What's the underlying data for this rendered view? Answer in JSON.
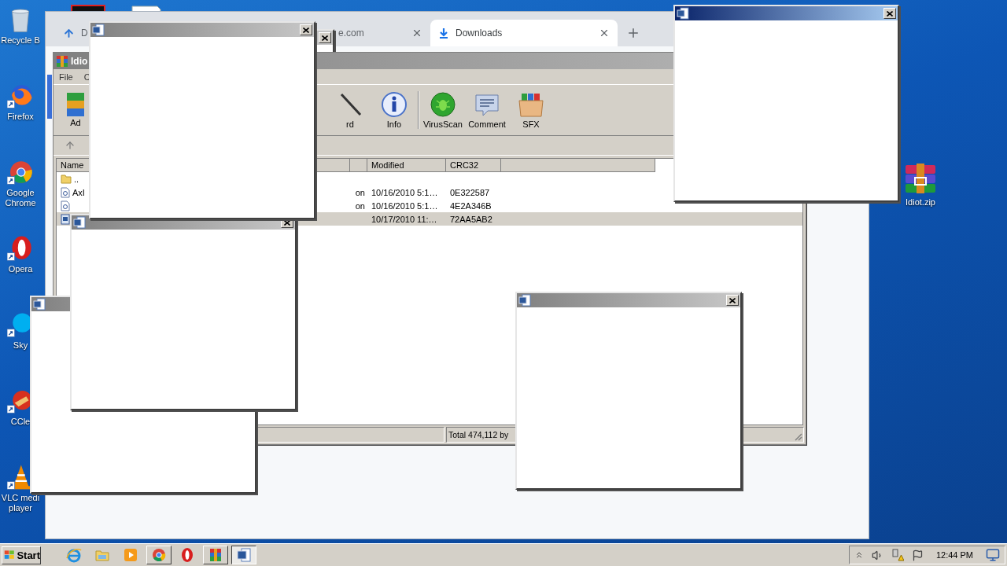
{
  "desktop_icons": [
    {
      "label": "Recycle B",
      "kind": "recycle"
    },
    {
      "label": "Firefox",
      "kind": "firefox"
    },
    {
      "label": "Google Chrome",
      "kind": "chrome"
    },
    {
      "label": "Opera",
      "kind": "opera"
    },
    {
      "label": "Sky",
      "kind": "skype"
    },
    {
      "label": "CCle",
      "kind": "ccleaner"
    },
    {
      "label": "VLC medi player",
      "kind": "vlc"
    }
  ],
  "zip_icon": {
    "label": "Idiot.zip"
  },
  "browser": {
    "tabs": [
      {
        "label": "D",
        "selected": false,
        "kind": "upload"
      },
      {
        "label": "e.com",
        "selected": false,
        "kind": "site"
      },
      {
        "label": "Downloads",
        "selected": true,
        "kind": "download"
      }
    ]
  },
  "archiver": {
    "title": "Idio",
    "menu": [
      "File",
      "C"
    ],
    "toolbar": [
      {
        "label": "Ad",
        "kind": "add"
      },
      {
        "label": "rd",
        "kind": "wizard"
      },
      {
        "label": "Info",
        "kind": "info"
      },
      {
        "label": "VirusScan",
        "kind": "virus"
      },
      {
        "label": "Comment",
        "kind": "comment"
      },
      {
        "label": "SFX",
        "kind": "sfx"
      }
    ],
    "columns": [
      "Name",
      "",
      "Modified",
      "CRC32"
    ],
    "rows": [
      {
        "kind": "folder",
        "name": "..",
        "selected": false
      },
      {
        "kind": "file",
        "name": "AxI",
        "type": "on",
        "modified": "10/16/2010 5:1…",
        "crc": "0E322587",
        "selected": false
      },
      {
        "kind": "file",
        "type": "on",
        "modified": "10/16/2010 5:1…",
        "crc": "4E2A346B",
        "selected": false
      },
      {
        "kind": "doc",
        "modified": "10/17/2010 11:…",
        "crc": "72AA5AB2",
        "selected": true
      }
    ],
    "status": "Total 474,112 by"
  },
  "popups": [
    {
      "active": false
    },
    {
      "active": false
    },
    {
      "active": false
    },
    {
      "active": false
    },
    {
      "active": false
    },
    {
      "active": true
    }
  ],
  "taskbar": {
    "start": "Start",
    "items": [
      {
        "kind": "ie",
        "open": false,
        "selected": false
      },
      {
        "kind": "explorer",
        "open": false,
        "selected": false
      },
      {
        "kind": "media",
        "open": false,
        "selected": false
      },
      {
        "kind": "chrome",
        "open": true,
        "selected": false
      },
      {
        "kind": "opera",
        "open": false,
        "selected": false
      },
      {
        "kind": "winrar",
        "open": true,
        "selected": false
      },
      {
        "kind": "word",
        "open": true,
        "selected": true
      }
    ],
    "clock": "12:44 PM"
  }
}
